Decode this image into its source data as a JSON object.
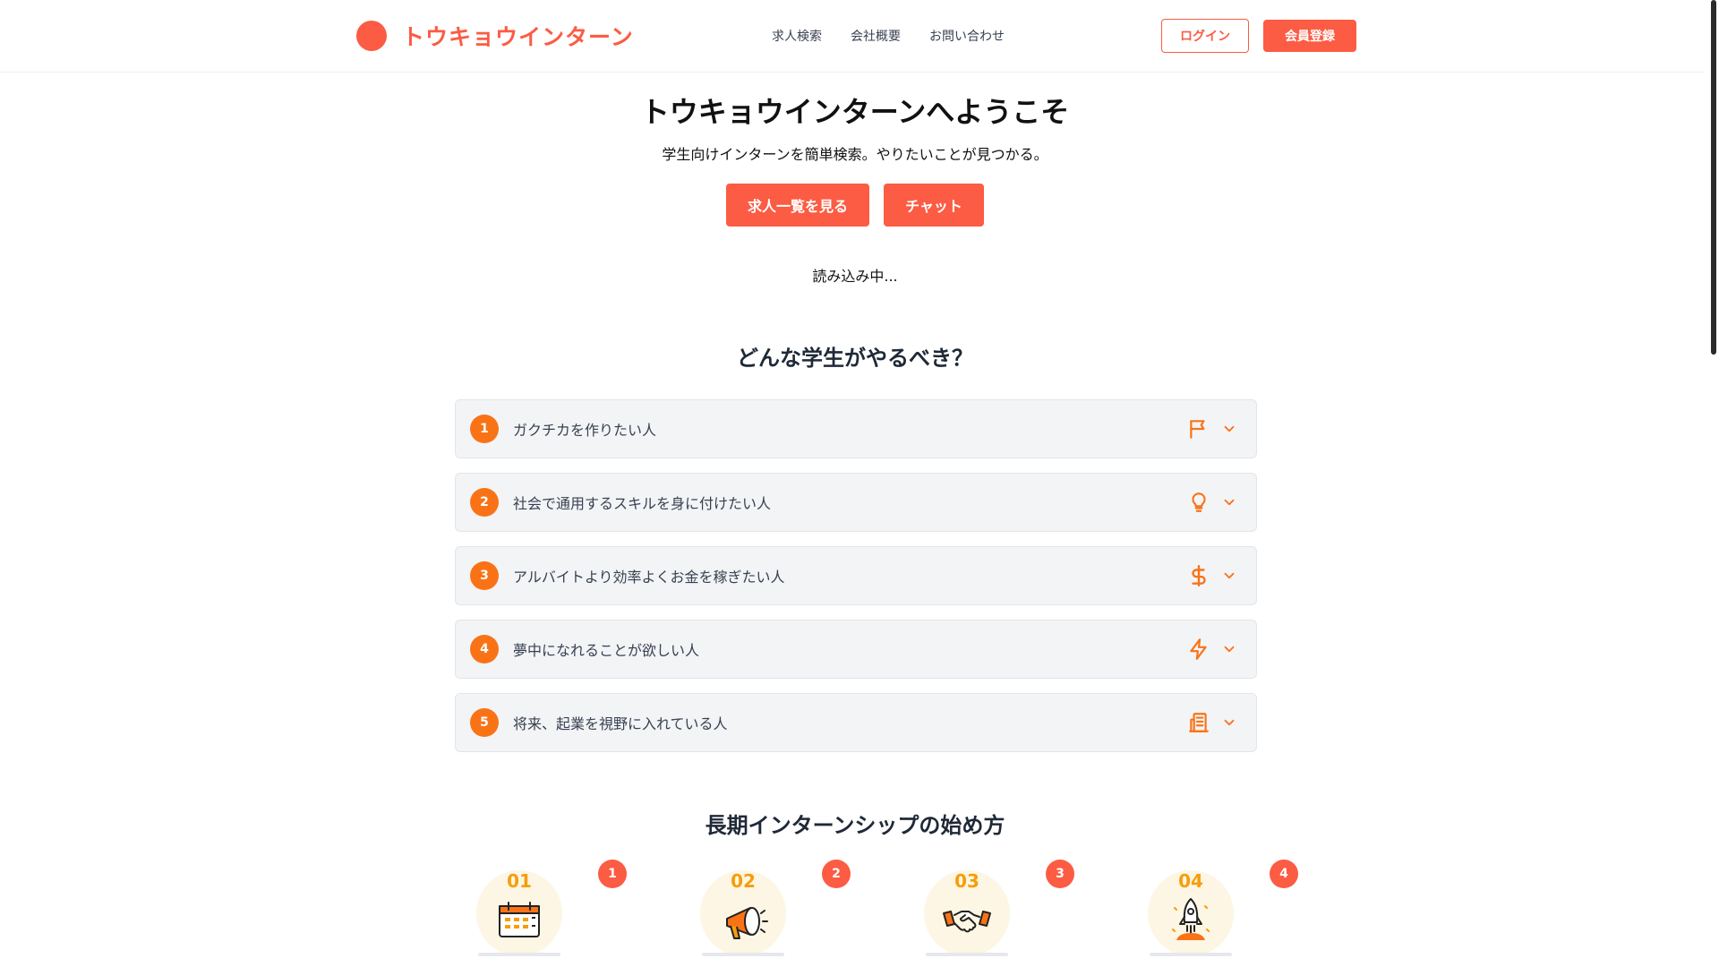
{
  "header": {
    "logo_text": "トウキョウインターン",
    "nav": [
      "求人検索",
      "会社概要",
      "お問い合わせ"
    ],
    "login_label": "ログイン",
    "signup_label": "会員登録"
  },
  "hero": {
    "title": "トウキョウインターンへようこそ",
    "subtitle": "学生向けインターンを簡単検索。やりたいことが見つかる。",
    "buttons": [
      "求人一覧を見る",
      "チャット"
    ],
    "loading_text": "読み込み中..."
  },
  "who": {
    "title": "どんな学生がやるべき？",
    "items": [
      {
        "num": "1",
        "text": "ガクチカを作りたい人",
        "icon": "flag-icon"
      },
      {
        "num": "2",
        "text": "社会で通用するスキルを身に付けたい人",
        "icon": "lightbulb-icon"
      },
      {
        "num": "3",
        "text": "アルバイトより効率よくお金を稼ぎたい人",
        "icon": "dollar-icon"
      },
      {
        "num": "4",
        "text": "夢中になれることが欲しい人",
        "icon": "lightning-icon"
      },
      {
        "num": "5",
        "text": "将来、起業を視野に入れている人",
        "icon": "building-icon"
      }
    ]
  },
  "steps": {
    "title": "長期インターンシップの始め方",
    "items": [
      {
        "num": "01",
        "badge": "1",
        "icon": "calendar-icon"
      },
      {
        "num": "02",
        "badge": "2",
        "icon": "megaphone-icon"
      },
      {
        "num": "03",
        "badge": "3",
        "icon": "handshake-icon"
      },
      {
        "num": "04",
        "badge": "4",
        "icon": "rocket-icon"
      }
    ]
  },
  "colors": {
    "accent": "#fb5c43",
    "orange": "#f97316",
    "gold": "#f59e0b"
  }
}
